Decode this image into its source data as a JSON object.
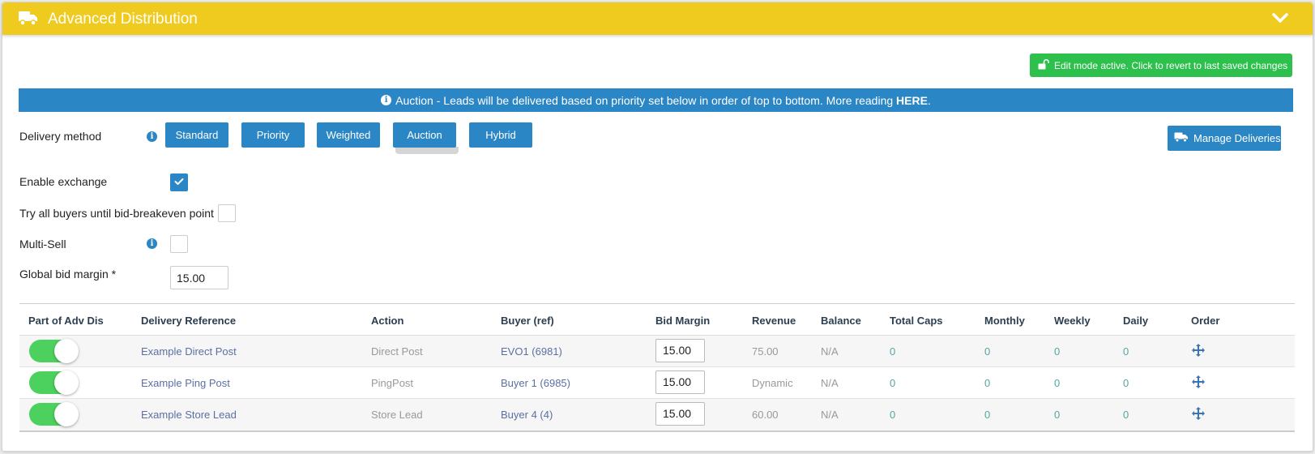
{
  "header": {
    "title": "Advanced Distribution",
    "icon": "truck-icon",
    "collapse_icon": "chevron-down-icon"
  },
  "edit_mode": {
    "label": "Edit mode active. Click to revert to last saved changes",
    "icon": "unlock-icon"
  },
  "info_bar": {
    "text": "Auction - Leads will be delivered based on priority set below in order of top to bottom. More reading ",
    "link": "HERE",
    "suffix": "."
  },
  "delivery_method": {
    "label": "Delivery method",
    "options": [
      "Standard",
      "Priority",
      "Weighted",
      "Auction",
      "Hybrid"
    ],
    "selected": "Auction"
  },
  "manage_deliveries": {
    "label": "Manage Deliveries",
    "icon": "truck-icon"
  },
  "settings": {
    "enable_exchange": {
      "label": "Enable exchange",
      "checked": true
    },
    "try_all_buyers": {
      "label": "Try all buyers until bid-breakeven point",
      "checked": false
    },
    "multi_sell": {
      "label": "Multi-Sell",
      "checked": false
    },
    "global_bid_margin": {
      "label": "Global bid margin *",
      "value": "15.00"
    }
  },
  "table": {
    "columns": [
      "Part of Adv Dis",
      "Delivery Reference",
      "Action",
      "Buyer (ref)",
      "Bid Margin",
      "Revenue",
      "Balance",
      "Total Caps",
      "Monthly",
      "Weekly",
      "Daily",
      "Order"
    ],
    "rows": [
      {
        "enabled": true,
        "reference": "Example Direct Post",
        "action": "Direct Post",
        "buyer": "EVO1 (6981)",
        "bid_margin": "15.00",
        "revenue": "75.00",
        "balance": "N/A",
        "total_caps": "0",
        "monthly": "0",
        "weekly": "0",
        "daily": "0"
      },
      {
        "enabled": true,
        "reference": "Example Ping Post",
        "action": "PingPost",
        "buyer": "Buyer 1 (6985)",
        "bid_margin": "15.00",
        "revenue": "Dynamic",
        "balance": "N/A",
        "total_caps": "0",
        "monthly": "0",
        "weekly": "0",
        "daily": "0"
      },
      {
        "enabled": true,
        "reference": "Example Store Lead",
        "action": "Store Lead",
        "buyer": "Buyer 4 (4)",
        "bid_margin": "15.00",
        "revenue": "60.00",
        "balance": "N/A",
        "total_caps": "0",
        "monthly": "0",
        "weekly": "0",
        "daily": "0"
      }
    ]
  },
  "colors": {
    "header_yellow": "#efcb1f",
    "primary_blue": "#2a86c5",
    "success_green": "#2dc04d",
    "toggle_green": "#4cd05e"
  }
}
